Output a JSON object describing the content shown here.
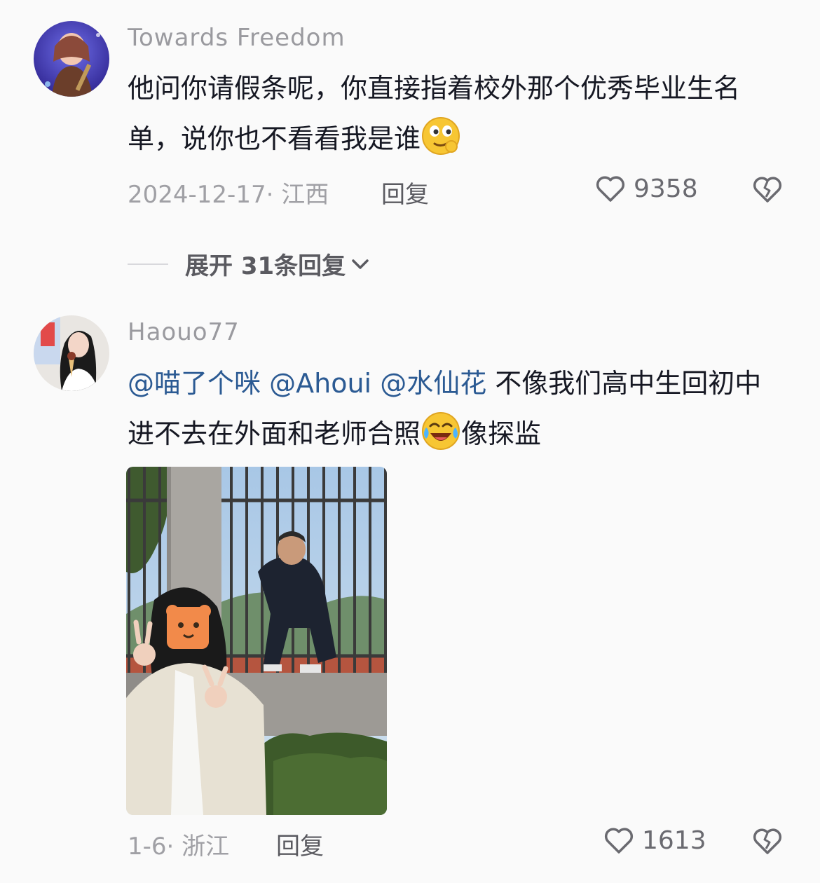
{
  "comments": [
    {
      "username": "Towards  Freedom",
      "text": "他问你请假条呢，你直接指着校外那个优秀毕业生名单，说你也不看看我是谁",
      "emoji": "smirk-emoji",
      "date_location": "2024-12-17· 江西",
      "reply_label": "回复",
      "likes": "9358",
      "expand_label": "展开 31条回复"
    },
    {
      "username": "Haouo77",
      "mentions": [
        "@喵了个咪",
        "@Ahoui",
        "@水仙花"
      ],
      "text_part1": "不像我们高中生回初中进不去在外面和老师合照",
      "emoji": "laughing-tears-emoji",
      "text_part2": "像探监",
      "date_location": "1-6· 浙江",
      "reply_label": "回复",
      "likes": "1613"
    }
  ],
  "colors": {
    "background": "#fafafa",
    "mention": "#2b5a93",
    "meta": "#a0a0a5"
  }
}
